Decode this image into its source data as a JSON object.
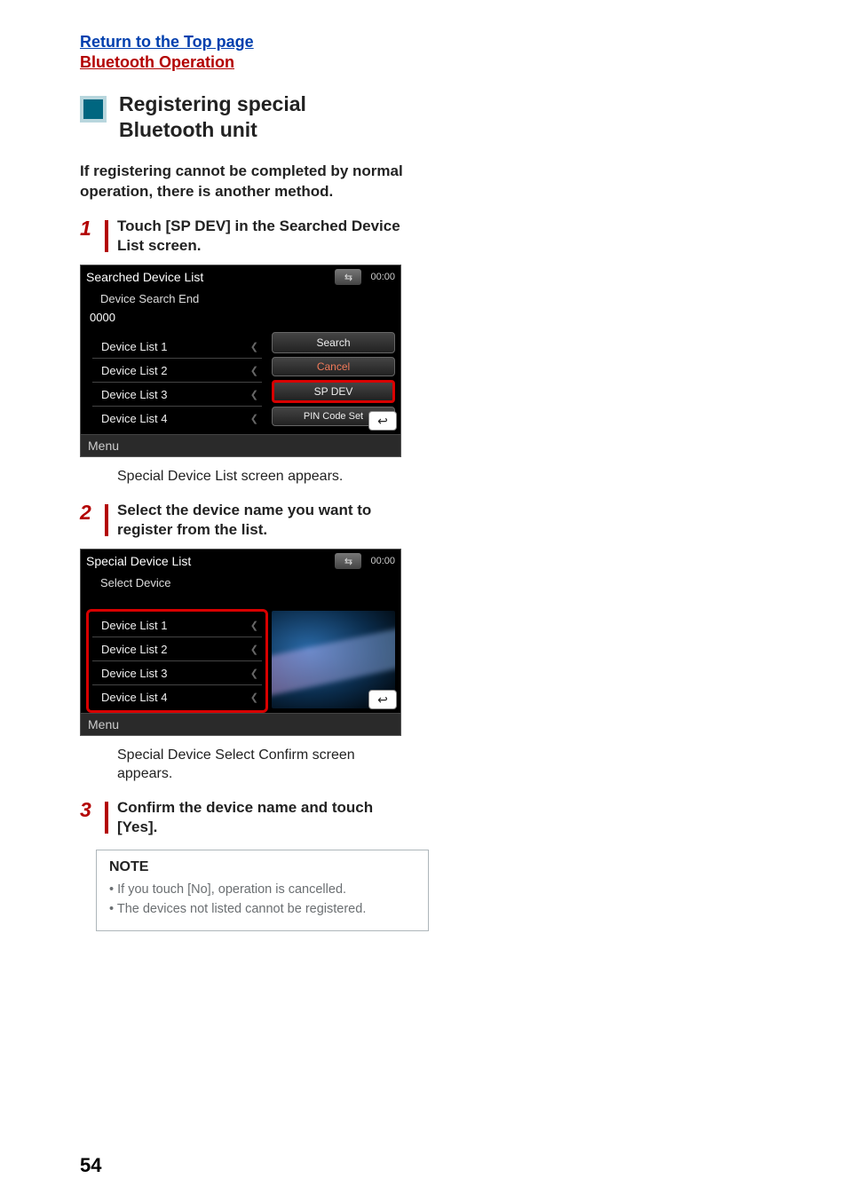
{
  "links": {
    "top": "Return to the Top page",
    "bt": "Bluetooth Operation"
  },
  "section_title": "Registering special Bluetooth unit",
  "intro": "If registering cannot be completed by normal operation, there is another method.",
  "steps": {
    "s1": {
      "num": "1",
      "text": "Touch [SP DEV] in the Searched Device List screen."
    },
    "s2": {
      "num": "2",
      "text": "Select the device name you want to register from the list."
    },
    "s3": {
      "num": "3",
      "text": "Confirm the device name and touch [Yes]."
    }
  },
  "results": {
    "r1": "Special Device List screen appears.",
    "r2": "Special Device Select Confirm screen appears."
  },
  "shot1": {
    "title": "Searched Device List",
    "time": "00:00",
    "sub": "Device Search End",
    "pin": "0000",
    "items": [
      "Device List 1",
      "Device List 2",
      "Device List 3",
      "Device List 4"
    ],
    "btns": {
      "search": "Search",
      "cancel": "Cancel",
      "spdev": "SP DEV",
      "pinset": "PIN Code Set"
    },
    "menu": "Menu"
  },
  "shot2": {
    "title": "Special Device List",
    "time": "00:00",
    "sub": "Select Device",
    "items": [
      "Device List 1",
      "Device List 2",
      "Device List 3",
      "Device List 4"
    ],
    "menu": "Menu"
  },
  "note": {
    "head": "NOTE",
    "n1": "If you touch [No], operation is cancelled.",
    "n2": "The devices not listed cannot be registered."
  },
  "page_num": "54"
}
